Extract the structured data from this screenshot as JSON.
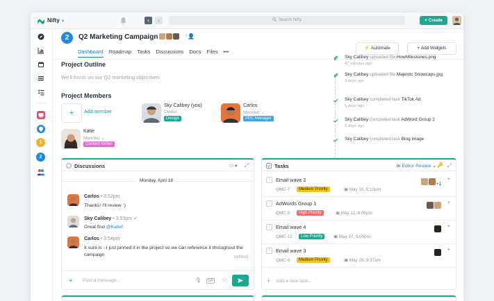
{
  "topbar": {
    "brand": "Nifty",
    "search_placeholder": "Search Nifty",
    "create_label": "+ Create"
  },
  "sidebar": {
    "items": [
      {
        "icon": "compass-icon"
      },
      {
        "icon": "chart-icon"
      },
      {
        "icon": "calendar-icon"
      },
      {
        "icon": "list-icon"
      },
      {
        "icon": "checklist-icon"
      }
    ],
    "projects": [
      {
        "label": "",
        "color": "#e24a6b"
      },
      {
        "label": "",
        "color": "#1e88e5"
      },
      {
        "label": "1",
        "color": "#f0b323"
      },
      {
        "label": "2",
        "color": "#1e88e5"
      }
    ]
  },
  "project": {
    "number": "2",
    "title": "Q2 Marketing Campaign",
    "tabs": [
      "Dashboard",
      "Roadmap",
      "Tasks",
      "Discussions",
      "Docs",
      "Files",
      "•••"
    ],
    "active_tab": "Dashboard",
    "automate_label": "Automate",
    "add_widgets_label": "Add Widgets"
  },
  "outline": {
    "title": "Project Outline",
    "text": "We'll focus on our Q2 marketing objectives"
  },
  "members": {
    "title": "Project Members",
    "add_label": "Add member",
    "list": [
      {
        "name": "Sky Calibey (you)",
        "role": "Owner",
        "tag": "Design",
        "tag_color": "#1aa891"
      },
      {
        "name": "Carlos",
        "role": "Member",
        "tag": "PPC Manager",
        "tag_color": "#3ba7e0"
      },
      {
        "name": "Katie",
        "role": "Member",
        "tag": "Content Writer",
        "tag_color": "#e56ad4"
      }
    ]
  },
  "feed": [
    {
      "actor": "Sky Calibey",
      "action": "uploaded file",
      "object": "HowMilestones.png",
      "time": "47 minutes ago",
      "icon": "paperclip-icon"
    },
    {
      "actor": "Sky Calibey",
      "action": "uploaded file",
      "object": "Majestic Snowcaps.jpg",
      "time": "3 days ago",
      "icon": "paperclip-icon"
    },
    {
      "actor": "Sky Calibey",
      "action": "completed task",
      "object": "TikTok Ad",
      "time": "5 days ago",
      "icon": "check-icon"
    },
    {
      "actor": "Sky Calibey",
      "action": "completed task",
      "object": "AdWord Group 2",
      "time": "5 days ago",
      "icon": "check-icon"
    },
    {
      "actor": "Sky Calibey",
      "action": "completed task",
      "object": "Blog image",
      "time": "",
      "icon": "check-icon"
    }
  ],
  "discussions": {
    "title": "Discussions",
    "date": "Monday, April 18",
    "messages": [
      {
        "author": "Carlos",
        "time": "3:52pm",
        "text": "Thanks! I'll review :)"
      },
      {
        "author": "Sky Calibey",
        "time": "3:53pm",
        "text_before": "Great find ",
        "mention": "@Katie",
        "text_after": "!"
      },
      {
        "author": "Carlos",
        "time": "3:54pm",
        "text": "It sure is - I just pinned it in the project so we can reference it throughout the campaign"
      }
    ],
    "edited_label": "(edited)",
    "composer_placeholder": "Post a message..."
  },
  "tasks": {
    "title": "Tasks",
    "filter_prefix": "In",
    "filter_value": "Editor Review",
    "items": [
      {
        "name": "Email wave 2",
        "id": "QMC-7",
        "priority": "Medium Priority",
        "priority_bg": "#f5c518",
        "priority_fg": "#3a2f00",
        "date": "May 10, 5:10pm",
        "extra": "+1"
      },
      {
        "name": "AdWords Group 1",
        "id": "QMC-9",
        "priority": "High Priority",
        "priority_bg": "#ef6b6b",
        "priority_fg": "#ffffff",
        "date": "May 12, 6:00pm",
        "extra": ""
      },
      {
        "name": "Email wave 4",
        "id": "QMC-12",
        "priority": "Low Priority",
        "priority_bg": "#1aa891",
        "priority_fg": "#ffffff",
        "date": "May 27, 5:00pm",
        "extra": ""
      },
      {
        "name": "Email wave 3",
        "id": "QMC-8",
        "priority": "Medium Priority",
        "priority_bg": "#f5c518",
        "priority_fg": "#3a2f00",
        "date": "May 29, 9:27am",
        "extra": ""
      }
    ],
    "add_task_label": "Add a new task..."
  }
}
